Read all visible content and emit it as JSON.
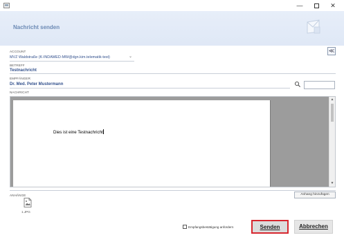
{
  "window": {
    "minimize_glyph": "—",
    "close_glyph": "✕"
  },
  "header": {
    "title": "Nachricht senden",
    "icon": "mail-envelope-icon"
  },
  "collapse_glyph": "≪",
  "form": {
    "account_label": "ACCOUNT",
    "account_value": "MVZ Waldstraße (K-INDAMED-MW@dgn.kim.telematik-test)",
    "account_chevron": "⌄",
    "subject_label": "BETREFF",
    "subject_value": "Testnachricht",
    "recipient_label": "EMPFÄNGER",
    "recipient_value": "Dr. Med. Peter Mustermann",
    "recipient_search_value": "",
    "message_label": "NACHRICHT",
    "message_text": "Dies ist eine Testnachricht"
  },
  "attachments": {
    "label": "ANHÄNGE",
    "add_button": "Anhang hinzufügen",
    "files": [
      {
        "name": "1.JPG",
        "icon": "image-file-icon"
      }
    ]
  },
  "footer": {
    "receipt_label": "Empfangsbestätigung anfordern",
    "receipt_checked": false,
    "send_button": "Senden",
    "cancel_button": "Abbrechen"
  },
  "colors": {
    "accent": "#33518d",
    "header_bg": "#e7eef9",
    "send_highlight": "#d7262e"
  }
}
